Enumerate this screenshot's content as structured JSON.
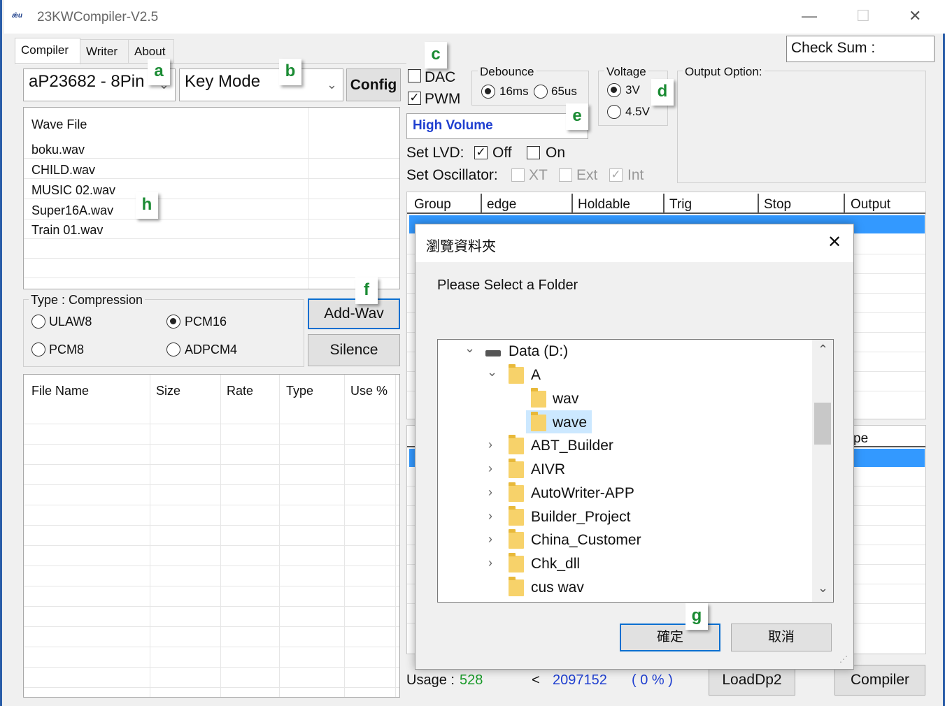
{
  "window": {
    "logo_text": "ǽu",
    "title": "23KWCompiler-V2.5",
    "minimize_glyph": "—",
    "maximize_glyph": "☐",
    "close_glyph": "✕"
  },
  "tabs": [
    {
      "label": "Compiler"
    },
    {
      "label": "Writer"
    },
    {
      "label": "About"
    }
  ],
  "checksum_label": "Check Sum :",
  "chip_select": "aP23682 - 8Pin",
  "mode_select": "Key Mode",
  "config_button": "Config",
  "dac_label": "DAC",
  "pwm_label": "PWM",
  "debounce": {
    "title": "Debounce",
    "opt1": "16ms",
    "opt2": "65us"
  },
  "voltage": {
    "title": "Voltage",
    "opt1": "3V",
    "opt2": "4.5V"
  },
  "output_option_label": "Output Option:",
  "volume_select": "High Volume",
  "lvd": {
    "label": "Set LVD:",
    "off": "Off",
    "on": "On"
  },
  "oscillator": {
    "label": "Set Oscillator:",
    "xt": "XT",
    "ext": "Ext",
    "int": "Int"
  },
  "group_table": {
    "headers": [
      "Group",
      "edge",
      "Holdable",
      "Trig",
      "Stop",
      "Output"
    ],
    "second_header_partial": "pe"
  },
  "wave_list": {
    "header": "Wave File",
    "files": [
      "boku.wav",
      "CHILD.wav",
      "MUSIC 02.wav",
      "Super16A.wav",
      "Train 01.wav"
    ]
  },
  "compression": {
    "title": "Type : Compression",
    "options": [
      "ULAW8",
      "PCM16",
      "PCM8",
      "ADPCM4"
    ],
    "selected": "PCM16"
  },
  "add_wav_button": "Add-Wav",
  "silence_button": "Silence",
  "file_table": {
    "headers": [
      "File Name",
      "Size",
      "Rate",
      "Type",
      "Use %"
    ]
  },
  "usage": {
    "label": "Usage :",
    "value": "528",
    "lt": "<",
    "max": "2097152",
    "percent": "( 0 % )"
  },
  "loaddp2_button": "LoadDp2",
  "compiler_button": "Compiler",
  "dialog": {
    "title": "瀏覽資料夾",
    "close_glyph": "✕",
    "prompt": "Please Select a Folder",
    "tree": [
      {
        "label": "Data (D:)",
        "expander": "⌄",
        "type": "drive"
      },
      {
        "label": "A",
        "expander": "⌄",
        "type": "folder"
      },
      {
        "label": "wav",
        "expander": "",
        "type": "folder"
      },
      {
        "label": "wave",
        "expander": "",
        "type": "folder",
        "selected": true
      },
      {
        "label": "ABT_Builder",
        "expander": "›",
        "type": "folder"
      },
      {
        "label": "AIVR",
        "expander": "›",
        "type": "folder"
      },
      {
        "label": "AutoWriter-APP",
        "expander": "›",
        "type": "folder"
      },
      {
        "label": "Builder_Project",
        "expander": "›",
        "type": "folder"
      },
      {
        "label": "China_Customer",
        "expander": "›",
        "type": "folder"
      },
      {
        "label": "Chk_dll",
        "expander": "›",
        "type": "folder"
      },
      {
        "label": "cus wav",
        "expander": "",
        "type": "folder"
      }
    ],
    "ok_button": "確定",
    "cancel_button": "取消"
  },
  "markers": {
    "a": "a",
    "b": "b",
    "c": "c",
    "d": "d",
    "e": "e",
    "f": "f",
    "g": "g",
    "h": "h"
  },
  "colors": {
    "accent": "#0b6fd0",
    "selected_row": "#3399ff",
    "marker_text": "#1a8b33",
    "usage_value": "#1a9a2a",
    "usage_max": "#1f3fd0"
  }
}
